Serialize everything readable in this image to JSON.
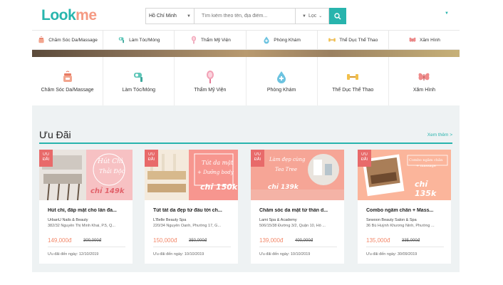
{
  "header": {
    "logo_main": "Look",
    "logo_accent": "me",
    "city": "Hồ Chí Minh",
    "search_placeholder": "Tìm kiếm theo tên, địa điểm...",
    "filter_label": "Lọc"
  },
  "categories": [
    {
      "label": "Chăm Sóc Da/Massage",
      "icon": "cosmetic-jar-icon"
    },
    {
      "label": "Làm Tóc/Móng",
      "icon": "hair-dryer-icon"
    },
    {
      "label": "Thẩm Mỹ Viện",
      "icon": "mirror-icon"
    },
    {
      "label": "Phòng Khám",
      "icon": "drop-icon"
    },
    {
      "label": "Thể Dục Thể Thao",
      "icon": "dumbbell-icon"
    },
    {
      "label": "Xăm Hình",
      "icon": "butterfly-icon"
    }
  ],
  "deals": {
    "title": "Ưu Đãi",
    "see_more": "Xem thêm >",
    "badge_line1": "ƯU",
    "badge_line2": "ĐÃI",
    "items": [
      {
        "name": "Hút chì, đắp mặt cho lần đa...",
        "shop": "UrbanU Nails & Beauty",
        "address": "382/32 Nguyễn Thị Minh Khai, P.5, Q...",
        "price": "149,000đ",
        "old_price": "300,000đ",
        "expiry": "Ưu đãi đến ngày: 12/10/2019",
        "promo_line1": "Hút Chì",
        "promo_line2": "Thải Độc",
        "promo_price": "chỉ 149k"
      },
      {
        "name": "Tút tát da đẹp từ đầu tới ch...",
        "shop": "L'Belle Beauty Spa",
        "address": "220/34 Nguyễn Oanh, Phường 17, G...",
        "price": "150,000đ",
        "old_price": "350,000đ",
        "expiry": "Ưu đãi đến ngày: 10/10/2019",
        "promo_line1": "Tút da mặt",
        "promo_line2": "+ Dưỡng body",
        "promo_price": "chỉ 150k"
      },
      {
        "name": "Chăm sóc da mặt từ thần d...",
        "shop": "Lami Spa & Academy",
        "address": "506/15/38 Đường 3/2, Quận 10, Hồ ...",
        "price": "139,000đ",
        "old_price": "400,000đ",
        "expiry": "Ưu đãi đến ngày: 10/10/2019",
        "promo_line1": "Làm đẹp cùng",
        "promo_line2": "Tea Tree",
        "promo_price": "chỉ 139k"
      },
      {
        "name": "Combo ngâm chân + Mass...",
        "shop": "Sewoon Beauty Salon & Spa",
        "address": "36 Bù Huỳnh Khương Ninh, Phường ...",
        "price": "135,000đ",
        "old_price": "335,000đ",
        "expiry": "Ưu đãi đến ngày: 30/09/2019",
        "promo_line1": "Combo ngâm chân",
        "promo_line2": "+ massage",
        "promo_price": "chỉ 135k"
      }
    ]
  },
  "colors": {
    "brand": "#28b4ad",
    "accent": "#f59a83",
    "price": "#f3896b",
    "badge": "#e86a6a"
  }
}
